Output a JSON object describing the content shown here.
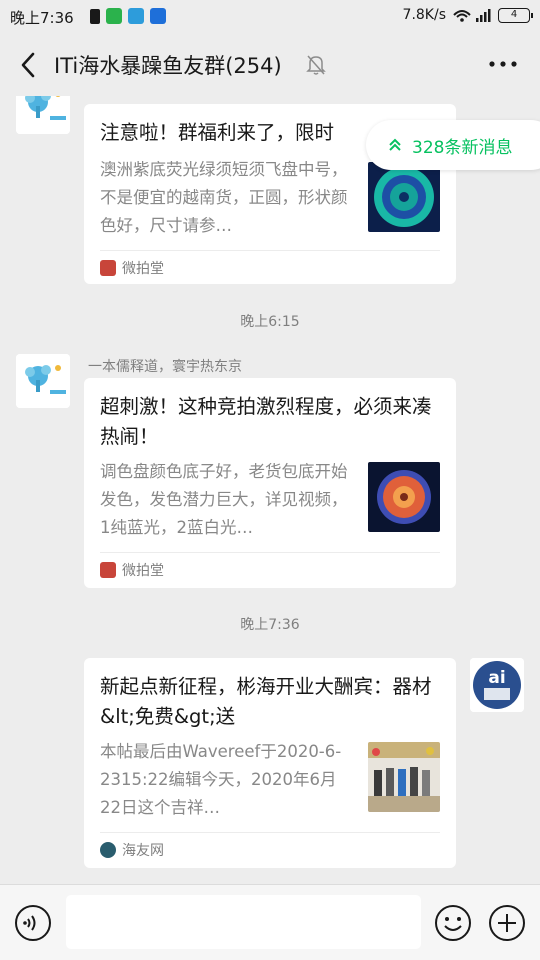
{
  "status_bar": {
    "time": "晚上7:36",
    "network_speed": "7.8K/s",
    "battery": "4"
  },
  "header": {
    "title": "ITi海水暴躁鱼友群(254)"
  },
  "new_messages_pill": {
    "label": "328条新消息"
  },
  "messages": [
    {
      "sender": "",
      "card": {
        "title": "注意啦！群福利来了，限时",
        "description": "澳洲紫底荧光绿须短须飞盘中号，不是便宜的越南货，正圆，形状颜色好，尺寸请参…",
        "source": "微拍堂"
      }
    },
    {
      "timestamp": "晚上6:15"
    },
    {
      "sender": "一本儒释道，寰宇热东京",
      "card": {
        "title": "超刺激！这种竞拍激烈程度，必须来凑热闹！",
        "description": "调色盘颜色底子好，老货包底开始发色，发色潜力巨大，详见视频，1纯蓝光，2蓝白光…",
        "source": "微拍堂"
      }
    },
    {
      "timestamp": "晚上7:36"
    },
    {
      "sender": "",
      "card": {
        "title": "新起点新征程，彬海开业大酬宾：器材&lt;免费&gt;送",
        "description": "本帖最后由Wavereef于2020-6-2315:22编辑今天，2020年6月22日这个吉祥…",
        "source": "海友网"
      }
    }
  ],
  "colors": {
    "accent": "#07c160",
    "source_red": "#c8453a",
    "background": "#ededed"
  },
  "icons": [
    "back-arrow-icon",
    "mute-bell-icon",
    "more-icon",
    "double-chevron-up-icon",
    "voice-icon",
    "emoji-icon",
    "plus-icon"
  ]
}
